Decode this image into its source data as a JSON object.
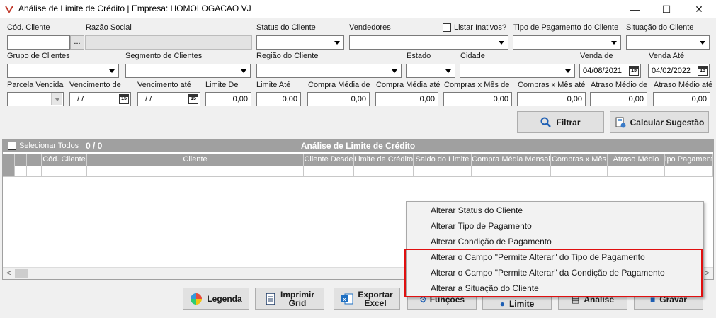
{
  "window": {
    "title": "Análise de Limite de Crédito | Empresa: HOMOLOGACAO VJ",
    "minimize": "—",
    "maximize": "☐",
    "close": "✕"
  },
  "filters": {
    "cod_cliente": "Cód. Cliente",
    "razao_social": "Razão Social",
    "ellipsis": "...",
    "status_cliente": "Status do Cliente",
    "vendedores": "Vendedores",
    "listar_inativos": "Listar Inativos?",
    "tipo_pagamento": "Tipo de Pagamento do Cliente",
    "situacao_cliente": "Situação do Cliente",
    "grupo_clientes": "Grupo de Clientes",
    "segmento_clientes": "Segmento de Clientes",
    "regiao_cliente": "Região do Cliente",
    "estado": "Estado",
    "cidade": "Cidade",
    "venda_de": "Venda de",
    "venda_de_value": "04/08/2021",
    "venda_ate": "Venda Até",
    "venda_ate_value": "04/02/2022",
    "parcela_vencida": "Parcela Vencida",
    "vencimento_de": "Vencimento de",
    "vencimento_de_value": "/ /",
    "vencimento_ate": "Vencimento até",
    "vencimento_ate_value": "/ /",
    "limite_de": "Limite De",
    "limite_de_value": "0,00",
    "limite_ate": "Limite Até",
    "limite_ate_value": "0,00",
    "compra_media_de": "Compra Média de",
    "compra_media_de_value": "0,00",
    "compra_media_ate": "Compra Média até",
    "compra_media_ate_value": "0,00",
    "compras_mes_de": "Compras x Mês de",
    "compras_mes_de_value": "0,00",
    "compras_mes_ate": "Compras x Mês até",
    "compras_mes_ate_value": "0,00",
    "atraso_medio_de": "Atraso Médio de",
    "atraso_medio_de_value": "0,00",
    "atraso_medio_ate": "Atraso Médio até",
    "atraso_medio_ate_value": "0,00",
    "calendar_glyph": "15"
  },
  "actions": {
    "filtrar": "Filtrar",
    "calcular_sugestao": "Calcular Sugestão"
  },
  "grid": {
    "title": "Análise de Limite de Crédito",
    "selecionar_todos": "Selecionar Todos",
    "count": "0 / 0",
    "columns": [
      "Cód. Cliente",
      "Cliente",
      "Cliente Desde",
      "Limite de Crédito",
      "Saldo do Limite",
      "Compra Média Mensal",
      "Compras x Mês",
      "Atraso Médio",
      "ipo Pagament"
    ],
    "scroll_left": "<",
    "scroll_right": ">"
  },
  "bottom_buttons": {
    "legenda": "Legenda",
    "imprimir_1": "Imprimir",
    "imprimir_2": "Grid",
    "exportar_1": "Exportar",
    "exportar_2": "Excel",
    "funcoes": "Funções",
    "limite": "Limite",
    "analise": "Análise",
    "gravar": "Gravar"
  },
  "context_menu": {
    "items": [
      "Alterar Status do Cliente",
      "Alterar Tipo de Pagamento",
      "Alterar Condição de Pagamento",
      "Alterar o Campo \"Permite Alterar\" do Tipo de Pagamento",
      "Alterar o Campo \"Permite Alterar\" da Condição de Pagamento",
      "Alterar a Situação do Cliente"
    ]
  },
  "colors": {
    "grid_header": "#a0a0a0",
    "highlight": "#e01010",
    "button_face": "#e1e1e1"
  }
}
